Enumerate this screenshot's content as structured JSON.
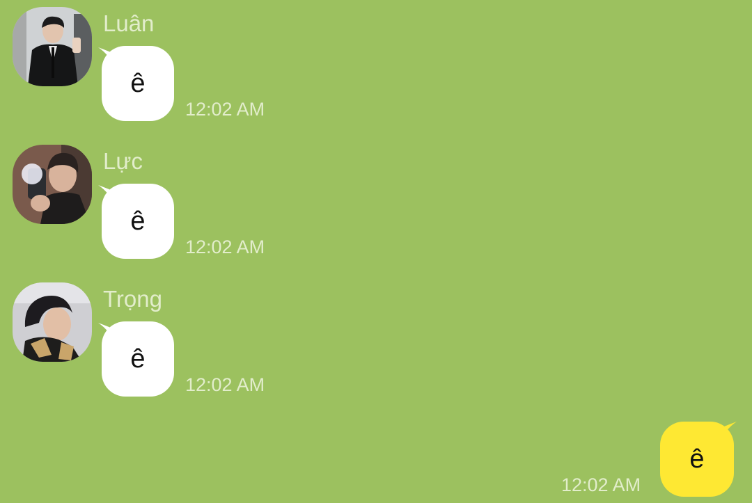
{
  "theme": {
    "chat_background": "#9CC15F",
    "incoming_bubble": "#FFFFFF",
    "outgoing_bubble": "#FEE833",
    "meta_text": "#E2EDCB"
  },
  "messages": [
    {
      "sender": "Luân",
      "text": "ê",
      "time": "12:02 AM",
      "avatar_icon": "profile-photo"
    },
    {
      "sender": "Lực",
      "text": "ê",
      "time": "12:02 AM",
      "avatar_icon": "profile-photo"
    },
    {
      "sender": "Trọng",
      "text": "ê",
      "time": "12:02 AM",
      "avatar_icon": "profile-photo"
    }
  ],
  "outgoing": {
    "text": "ê",
    "time": "12:02 AM"
  }
}
